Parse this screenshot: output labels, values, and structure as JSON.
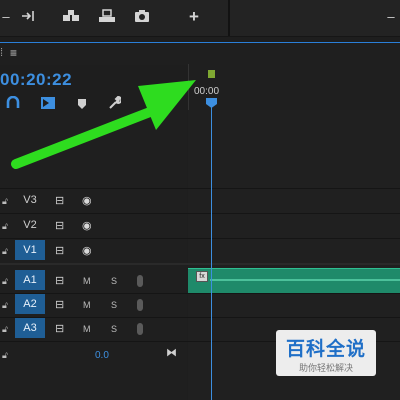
{
  "toolbar": {
    "icons": [
      "ripple-edit-icon",
      "track-select-icon",
      "lift-icon",
      "extract-icon",
      "camera-icon",
      "add-icon"
    ],
    "add_label": "+"
  },
  "panel": {
    "menu_label": "≡"
  },
  "timecode": "00:20:22",
  "ruler": {
    "time_label": "00:00"
  },
  "tracks": {
    "video": [
      {
        "name": "V3",
        "selected": false
      },
      {
        "name": "V2",
        "selected": false
      },
      {
        "name": "V1",
        "selected": true
      }
    ],
    "audio": [
      {
        "name": "A1",
        "selected": true,
        "mute": "M",
        "solo": "S"
      },
      {
        "name": "A2",
        "selected": true,
        "mute": "M",
        "solo": "S"
      },
      {
        "name": "A3",
        "selected": true,
        "mute": "M",
        "solo": "S"
      }
    ]
  },
  "master": {
    "volume": "0.0"
  },
  "clip": {
    "fx_label": "fx"
  },
  "watermark": {
    "title": "百科全说",
    "subtitle": "助你轻松解决"
  },
  "colors": {
    "accent": "#3d8fe0",
    "clip": "#1f8a6a",
    "marker": "#7fa832",
    "arrow": "#2edc1f"
  }
}
